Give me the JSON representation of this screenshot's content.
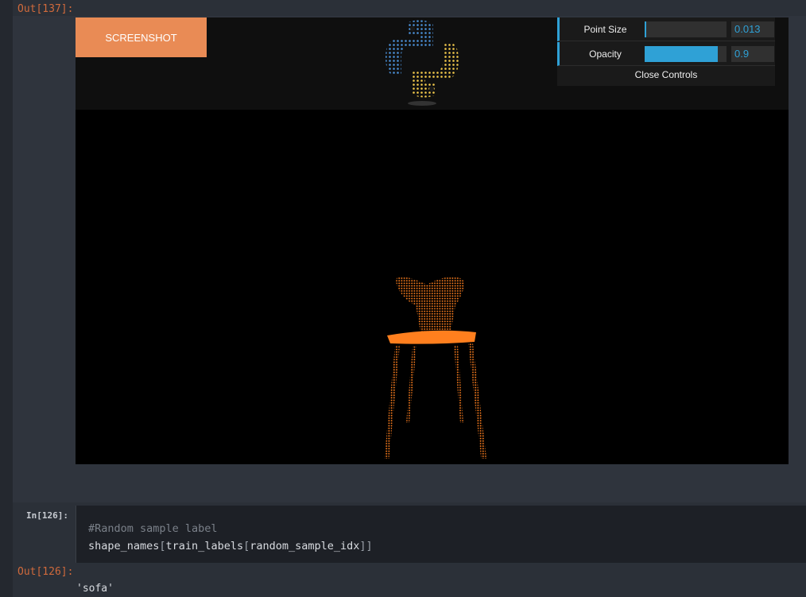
{
  "cells": [
    {
      "out_prompt": "Out[137]",
      "viewer": {
        "screenshot_label": "SCREENSHOT",
        "controls": {
          "point_size_label": "Point Size",
          "point_size_value": "0.013",
          "point_size_fraction": 0.0,
          "opacity_label": "Opacity",
          "opacity_value": "0.9",
          "opacity_fraction": 0.9,
          "close_label": "Close Controls",
          "accent_color": "#2fa1d6"
        },
        "logo": "python-logo",
        "point_cloud_color": "#ff7f1e"
      }
    },
    {
      "in_prompt": "In[126]",
      "code_comment": "#Random sample label",
      "code_line": {
        "fn": "shape_names",
        "lb1": "[",
        "inner": "train_labels",
        "lb2": "[",
        "arg": "random_sample_idx",
        "rb": "]]"
      },
      "out_prompt": "Out[126]",
      "output": "'sofa'"
    }
  ],
  "colon": ":"
}
